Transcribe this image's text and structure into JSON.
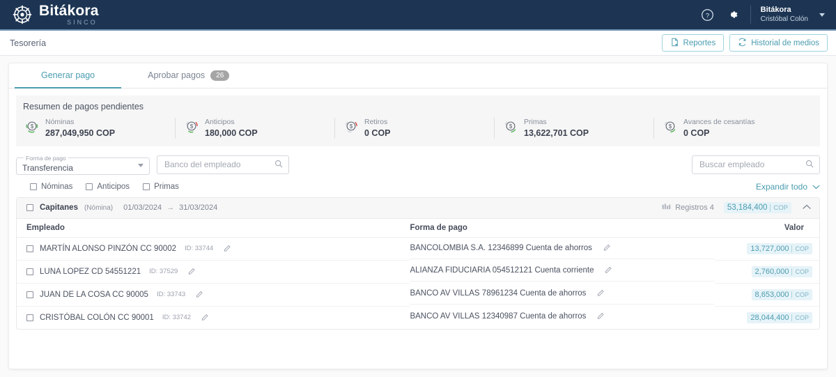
{
  "topbar": {
    "brand_name": "Bitákora",
    "brand_sub": "SINCO",
    "help_icon": "help-circle-icon",
    "settings_icon": "gear-icon",
    "user_org": "Bitákora",
    "user_name": "Cristóbal Colón"
  },
  "subbar": {
    "breadcrumb": "Tesorería",
    "reports_label": "Reportes",
    "history_label": "Historial de medios"
  },
  "tabs": [
    {
      "label": "Generar pago",
      "badge": ""
    },
    {
      "label": "Aprobar pagos",
      "badge": "26"
    }
  ],
  "summary": {
    "title": "Resumen de pagos pendientes",
    "items": [
      {
        "label": "Nóminas",
        "value": "287,049,950 COP"
      },
      {
        "label": "Anticipos",
        "value": "180,000 COP"
      },
      {
        "label": "Retiros",
        "value": "0 COP"
      },
      {
        "label": "Primas",
        "value": "13,622,701 COP"
      },
      {
        "label": "Avances de cesantías",
        "value": "0 COP"
      }
    ]
  },
  "filters": {
    "payment_method_legend": "Forma de pago",
    "payment_method_value": "Transferencia",
    "bank_placeholder": "Banco del empleado",
    "employee_search_placeholder": "Buscar empleado",
    "checkboxes": [
      {
        "label": "Nóminas"
      },
      {
        "label": "Anticipos"
      },
      {
        "label": "Primas"
      }
    ],
    "expand_all": "Expandir todo"
  },
  "group": {
    "name": "Capitanes",
    "type": "(Nómina)",
    "date_from": "01/03/2024",
    "date_arrow": "→",
    "date_to": "31/03/2024",
    "records_label": "Registros 4",
    "total_value": "53,184,400",
    "total_currency": "COP",
    "columns": {
      "employee": "Empleado",
      "payment_method": "Forma de pago",
      "value": "Valor"
    },
    "rows": [
      {
        "employee": "MARTÍN ALONSO PINZÓN CC 90002",
        "employee_id": "ID: 33744",
        "payment_method": "BANCOLOMBIA S.A. 12346899 Cuenta de ahorros",
        "value": "13,727,000",
        "currency": "COP"
      },
      {
        "employee": "LUNA LOPEZ CD 54551221",
        "employee_id": "ID: 37529",
        "payment_method": "ALIANZA FIDUCIARIA 054512121 Cuenta corriente",
        "value": "2,760,000",
        "currency": "COP"
      },
      {
        "employee": "JUAN DE LA COSA CC 90005",
        "employee_id": "ID: 33743",
        "payment_method": "BANCO AV VILLAS 78961234 Cuenta de ahorros",
        "value": "8,653,000",
        "currency": "COP"
      },
      {
        "employee": "CRISTÓBAL COLÓN CC 90001",
        "employee_id": "ID: 33742",
        "payment_method": "BANCO AV VILLAS 12340987 Cuenta de ahorros",
        "value": "28,044,400",
        "currency": "COP"
      }
    ]
  },
  "colors": {
    "navy": "#1d3553",
    "teal": "#4b9cb0",
    "pill_bg": "#e6f3f8",
    "badge_gray": "#a5a5a5"
  }
}
